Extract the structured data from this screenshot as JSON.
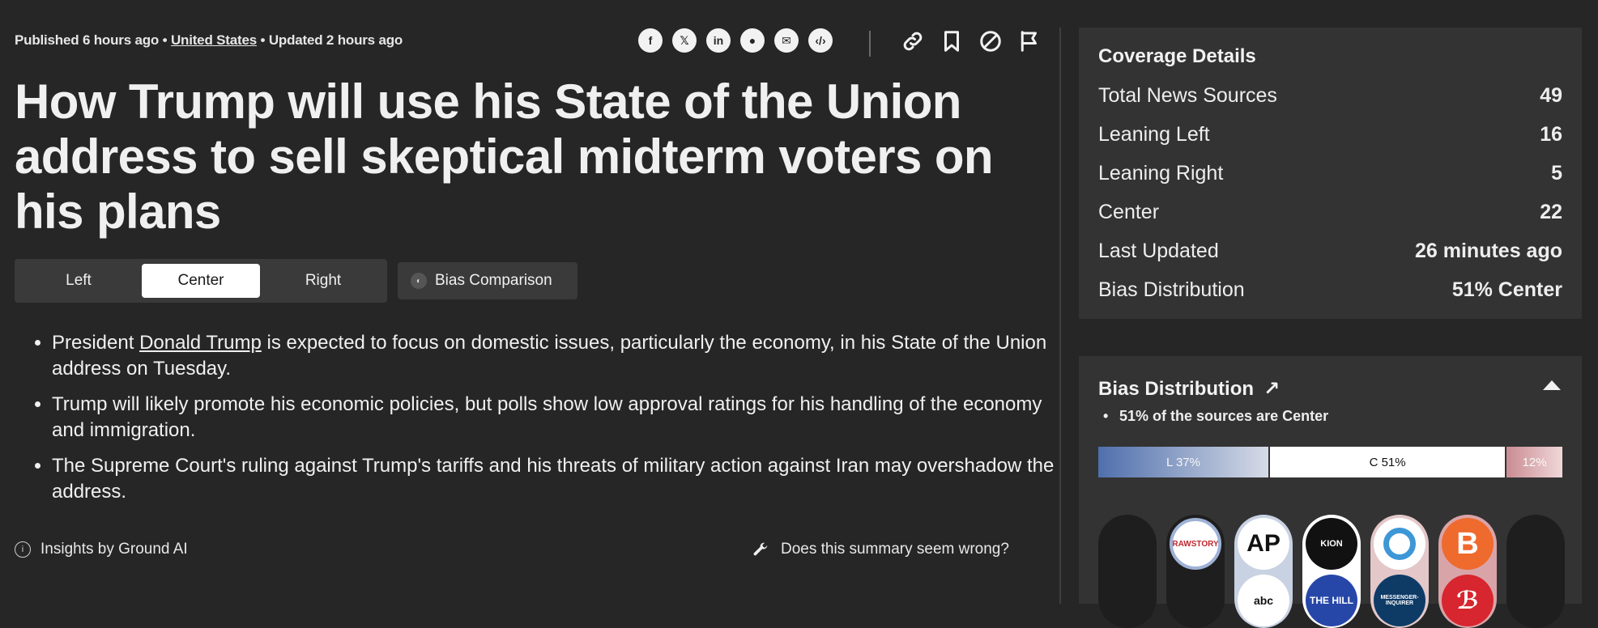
{
  "meta": {
    "published": "Published 6 hours ago",
    "sep": "•",
    "country": "United States",
    "updated": "Updated 2 hours ago"
  },
  "share_icons": [
    "facebook-icon",
    "x-icon",
    "linkedin-icon",
    "reddit-icon",
    "email-icon",
    "embed-icon"
  ],
  "tool_icons": [
    "link-icon",
    "bookmark-icon",
    "block-icon",
    "flag-icon"
  ],
  "title": "How Trump will use his State of the Union address to sell skeptical midterm voters on his plans",
  "tabs": {
    "left": "Left",
    "center": "Center",
    "right": "Right",
    "active": "Center"
  },
  "bias_comparison": "Bias Comparison",
  "summary": {
    "b1_pre": "President ",
    "b1_link": "Donald Trump",
    "b1_post": " is expected to focus on domestic issues, particularly the economy, in his State of the Union address on Tuesday.",
    "b2": "Trump will likely promote his economic policies, but polls show low approval ratings for his handling of the economy and immigration.",
    "b3": "The Supreme Court's ruling against Trump's tariffs and his threats of military action against Iran may overshadow the address."
  },
  "insights": "Insights by Ground AI",
  "wrong": "Does this summary seem wrong?",
  "coverage": {
    "title": "Coverage Details",
    "rows": [
      {
        "label": "Total News Sources",
        "value": "49"
      },
      {
        "label": "Leaning Left",
        "value": "16"
      },
      {
        "label": "Leaning Right",
        "value": "5"
      },
      {
        "label": "Center",
        "value": "22"
      },
      {
        "label": "Last Updated",
        "value": "26 minutes ago"
      },
      {
        "label": "Bias Distribution",
        "value": "51% Center"
      }
    ]
  },
  "bias_dist": {
    "title": "Bias Distribution",
    "arrow": "↗",
    "subtitle": "51% of the sources are Center",
    "left": {
      "label": "L 37%",
      "percent": 37
    },
    "center": {
      "label": "C 51%",
      "percent": 51
    },
    "right": {
      "label": "12%",
      "percent": 12
    }
  },
  "source_logos": {
    "rawstory": "RAWSTORY",
    "ap": "AP",
    "abc": "abc",
    "thehill": "THE HILL",
    "blaze": "B",
    "enquirer": "MESSENGER-INQUIRER"
  },
  "colors": {
    "background": "#262626",
    "panel": "#333333",
    "left_bias": "#4f6fad",
    "center_bias": "#ffffff",
    "right_bias": "#c98c92"
  }
}
